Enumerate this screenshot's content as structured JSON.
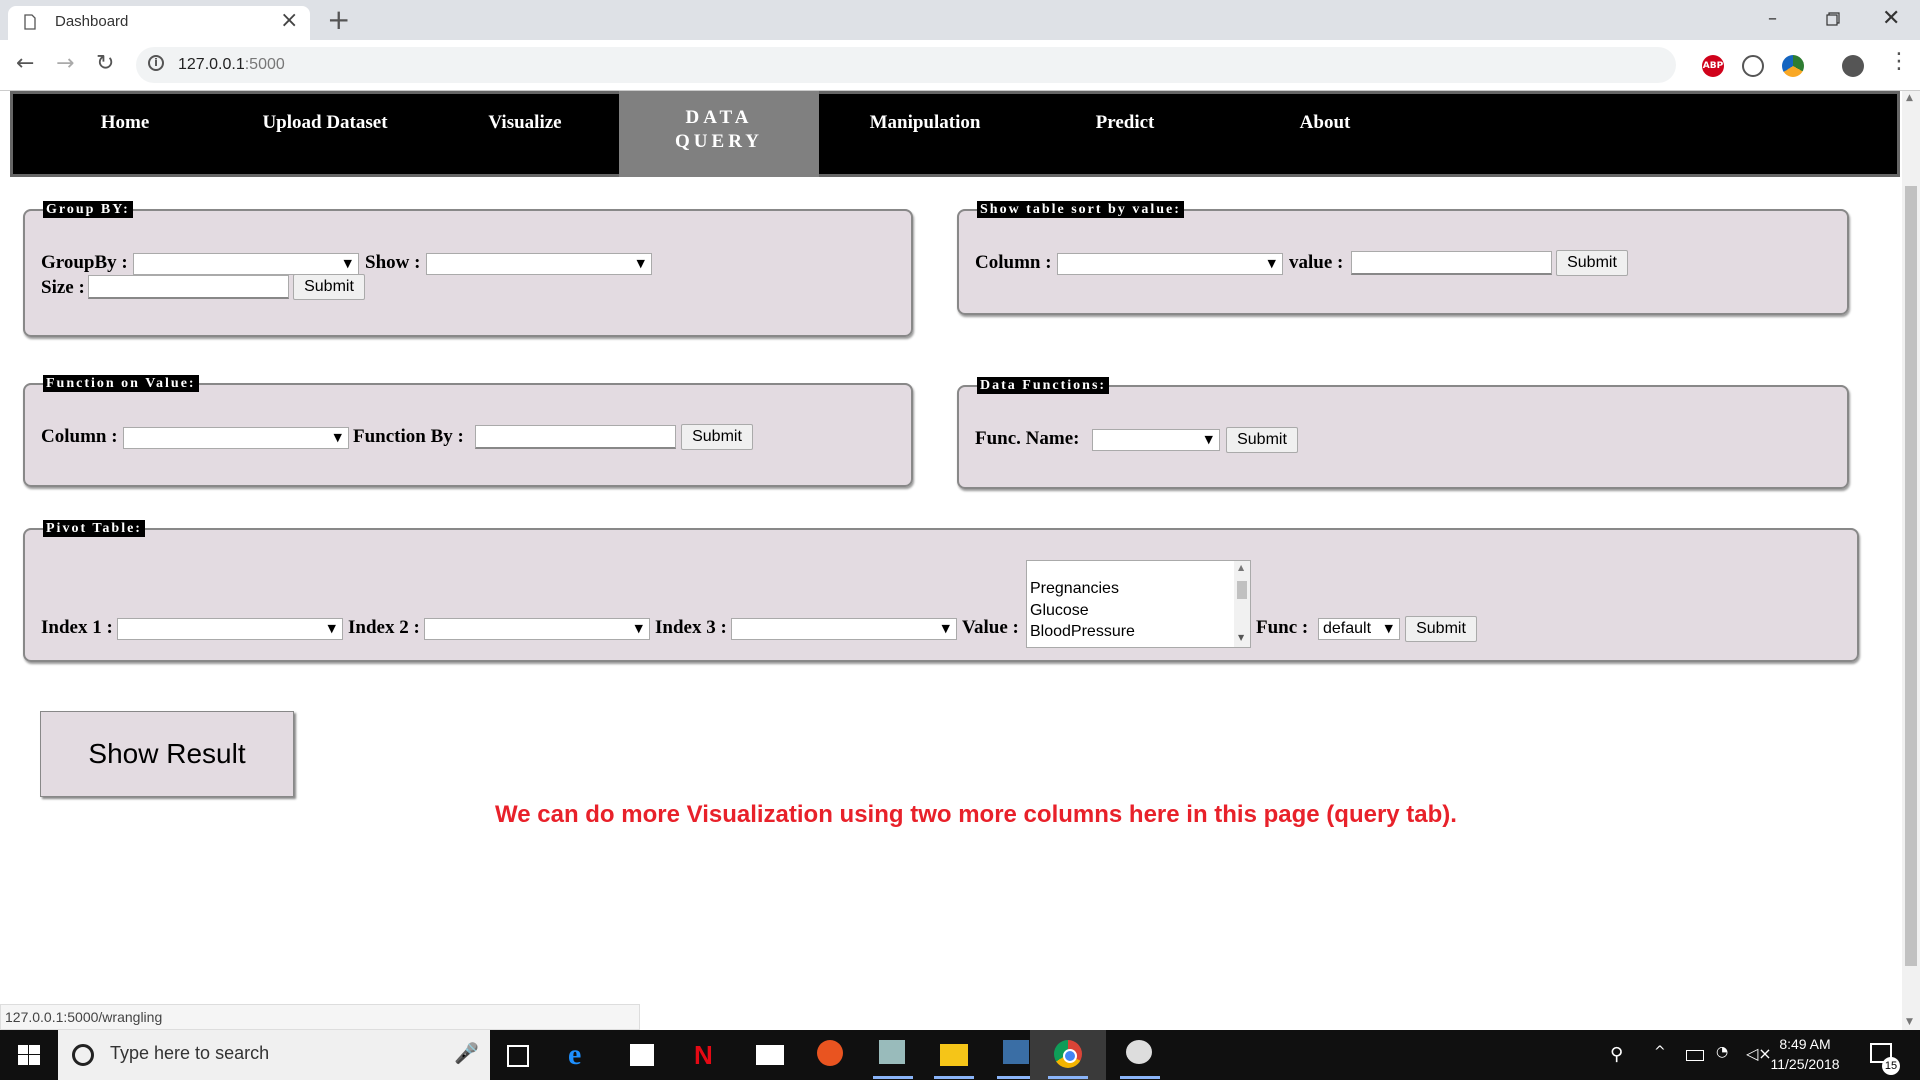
{
  "browser": {
    "tab_title": "Dashboard",
    "url_host": "127.0.0.1",
    "url_port": ":5000",
    "status_url": "127.0.0.1:5000/wrangling"
  },
  "nav": {
    "items": [
      "Home",
      "Upload Dataset",
      "Visualize",
      "DATA QUERY",
      "Manipulation",
      "Predict",
      "About"
    ],
    "active_line1": "DATA",
    "active_line2": "QUERY"
  },
  "group_by": {
    "legend": "Group BY:",
    "groupby_label": "GroupBy :",
    "show_label": "Show :",
    "size_label": "Size :",
    "submit": "Submit"
  },
  "sort_by_value": {
    "legend": "Show table sort by value:",
    "column_label": "Column :",
    "value_label": "value :",
    "submit": "Submit"
  },
  "function_on_value": {
    "legend": "Function on Value:",
    "column_label": "Column :",
    "function_by_label": "Function By :",
    "submit": "Submit"
  },
  "data_functions": {
    "legend": "Data Functions:",
    "func_name_label": "Func. Name:",
    "submit": "Submit"
  },
  "pivot": {
    "legend": "Pivot Table:",
    "index1_label": "Index 1 :",
    "index2_label": "Index 2 :",
    "index3_label": "Index 3 :",
    "value_label": "Value :",
    "value_options": [
      "Pregnancies",
      "Glucose",
      "BloodPressure"
    ],
    "func_label": "Func :",
    "func_selected": "default",
    "submit": "Submit"
  },
  "show_result": "Show Result",
  "note": "We can do more Visualization using two more columns here in this page (query tab).",
  "taskbar": {
    "search_placeholder": "Type here to search",
    "time": "8:49 AM",
    "date": "11/25/2018",
    "notification_count": "15"
  },
  "colors": {
    "panel_bg": "#e3dbe1",
    "nav_bg": "#000000",
    "nav_active": "#808080",
    "note": "#e8212a"
  }
}
